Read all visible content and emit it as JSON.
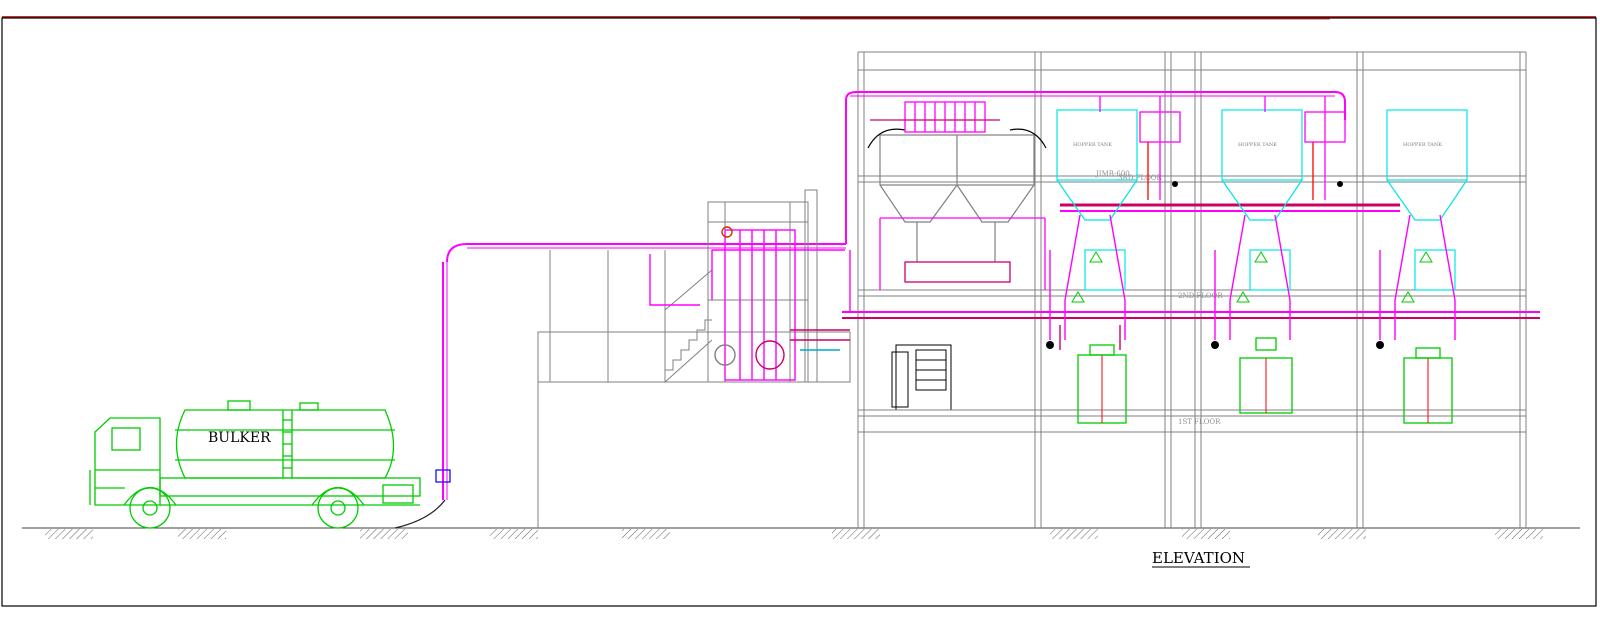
{
  "drawing": {
    "view_title": "ELEVATION",
    "vehicle_label": "BULKER",
    "equipment_tag": "JIMB-600",
    "floor_labels": {
      "upper": "3RD FLOOR",
      "middle": "2ND FLOOR",
      "lower": "1ST FLOOR"
    },
    "hopper_tag": "HOPPER TANK"
  },
  "colors": {
    "pipe": "#ff00ff",
    "pipe_dark": "#cc0066",
    "structure": "#808080",
    "vehicle": "#00cc00",
    "tank_outline": "#00e5e5",
    "frame": "#000000",
    "border_top": "#800000",
    "red_line": "#ff0000",
    "blue": "#0000ff"
  }
}
